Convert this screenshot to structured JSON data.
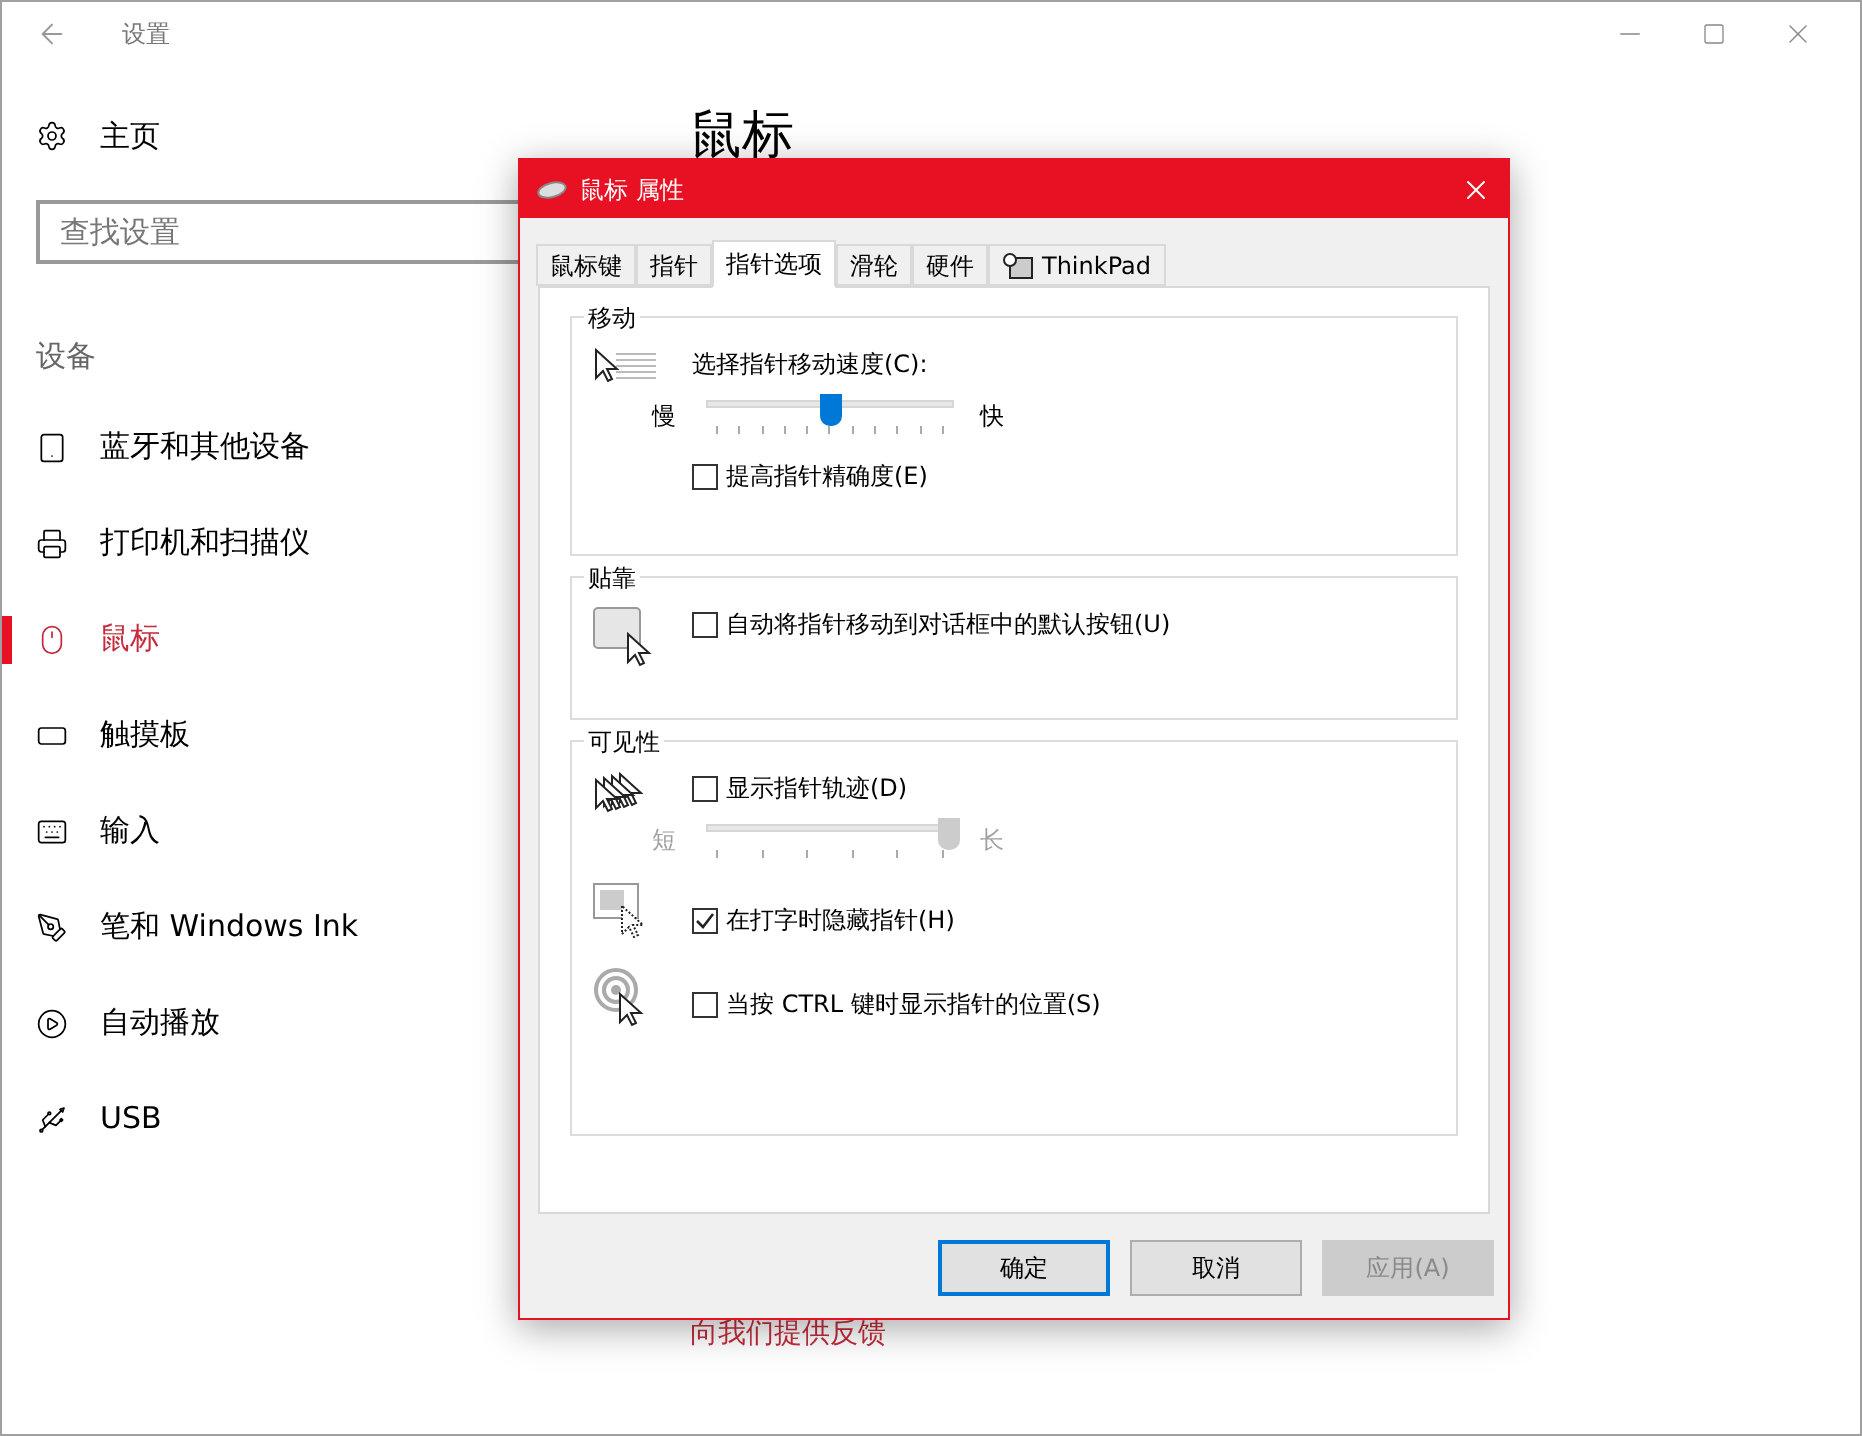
{
  "window": {
    "title": "设置"
  },
  "sidebar": {
    "home": "主页",
    "search": {
      "placeholder": "查找设置"
    },
    "section": "设备",
    "items": [
      {
        "label": "蓝牙和其他设备",
        "selected": false
      },
      {
        "label": "打印机和扫描仪",
        "selected": false
      },
      {
        "label": "鼠标",
        "selected": true
      },
      {
        "label": "触摸板",
        "selected": false
      },
      {
        "label": "输入",
        "selected": false
      },
      {
        "label": "笔和 Windows Ink",
        "selected": false
      },
      {
        "label": "自动播放",
        "selected": false
      },
      {
        "label": "USB",
        "selected": false
      }
    ]
  },
  "main": {
    "heading": "鼠标",
    "feedback_link": "向我们提供反馈"
  },
  "dialog": {
    "title": "鼠标 属性",
    "tabs": [
      {
        "label": "鼠标键",
        "selected": false,
        "kind": "text"
      },
      {
        "label": "指针",
        "selected": false,
        "kind": "text"
      },
      {
        "label": "指针选项",
        "selected": true,
        "kind": "text"
      },
      {
        "label": "滑轮",
        "selected": false,
        "kind": "text"
      },
      {
        "label": "硬件",
        "selected": false,
        "kind": "text"
      },
      {
        "label": "ThinkPad",
        "selected": false,
        "kind": "icon"
      }
    ],
    "groups": [
      {
        "title": "移动",
        "blocks": [
          {
            "rows": [
              {
                "kind": "label",
                "label": "选择指针移动速度(C):"
              },
              {
                "kind": "slider",
                "min_label": "慢",
                "max_label": "快",
                "level": 0.5,
                "disabled": false
              }
            ]
          },
          {
            "rows": [
              {
                "kind": "checkbox",
                "label": "提高指针精确度(E)",
                "checked": false
              }
            ]
          }
        ]
      },
      {
        "title": "贴靠",
        "blocks": [
          {
            "rows": [
              {
                "kind": "checkbox",
                "label": "自动将指针移动到对话框中的默认按钮(U)",
                "checked": false
              }
            ]
          }
        ]
      },
      {
        "title": "可见性",
        "blocks": [
          {
            "rows": [
              {
                "kind": "checkbox",
                "label": "显示指针轨迹(D)",
                "checked": false
              },
              {
                "kind": "slider",
                "min_label": "短",
                "max_label": "长",
                "level": 1,
                "disabled": true
              }
            ]
          },
          {
            "rows": [
              {
                "kind": "checkbox",
                "label": "在打字时隐藏指针(H)",
                "checked": true
              }
            ]
          },
          {
            "rows": [
              {
                "kind": "checkbox",
                "label": "当按 CTRL 键时显示指针的位置(S)",
                "checked": false
              }
            ]
          }
        ]
      }
    ],
    "buttons": [
      {
        "label": "确定",
        "default": true,
        "disabled": false
      },
      {
        "label": "取消",
        "default": false,
        "disabled": false
      },
      {
        "label": "应用(A)",
        "default": false,
        "disabled": true
      }
    ]
  }
}
